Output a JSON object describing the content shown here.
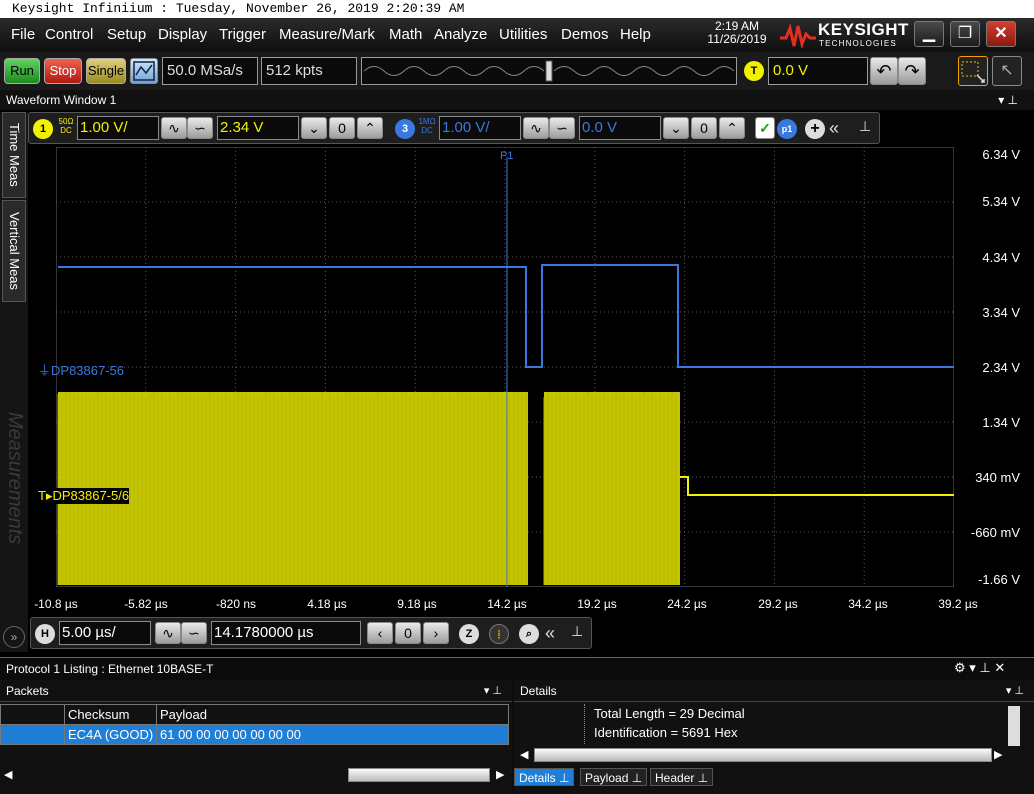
{
  "titlebar": {
    "text": "Keysight Infiniium : Tuesday, November 26, 2019 2:20:39 AM"
  },
  "menu": [
    "File",
    "Control",
    "Setup",
    "Display",
    "Trigger",
    "Measure/Mark",
    "Math",
    "Analyze",
    "Utilities",
    "Demos",
    "Help"
  ],
  "clock": {
    "time": "2:19 AM",
    "date": "11/26/2019"
  },
  "brand": {
    "name": "KEYSIGHT",
    "sub": "TECHNOLOGIES",
    "color": "#e03020"
  },
  "toolbar": {
    "run": "Run",
    "stop": "Stop",
    "single": "Single",
    "sample_rate": "50.0 MSa/s",
    "memory_depth": "512 kpts",
    "trigger_level": "0.0 V",
    "trigger_badge": "T"
  },
  "waveform_window": {
    "title": "Waveform Window 1"
  },
  "channels": {
    "ch1": {
      "badge": "1",
      "coupling_top": "50Ω",
      "coupling_bot": "DC",
      "scale": "1.00 V/",
      "offset": "2.34 V",
      "color": "#f2f200"
    },
    "ch3": {
      "badge": "3",
      "coupling_top": "1MΩ",
      "coupling_bot": "DC",
      "scale": "1.00 V/",
      "offset": "0.0 V",
      "color": "#3a78e0"
    }
  },
  "side_tabs": {
    "time_meas": "Time Meas",
    "vertical_meas": "Vertical Meas",
    "measurements": "Measurements"
  },
  "y_axis_labels": [
    "6.34 V",
    "5.34 V",
    "4.34 V",
    "3.34 V",
    "2.34 V",
    "1.34 V",
    "340 mV",
    "-660 mV",
    "-1.66 V"
  ],
  "x_axis_labels": [
    "-10.8 µs",
    "-5.82 µs",
    "-820 ns",
    "4.18 µs",
    "9.18 µs",
    "14.2 µs",
    "19.2 µs",
    "24.2 µs",
    "29.2 µs",
    "34.2 µs",
    "39.2 µs"
  ],
  "trace_labels": {
    "blue": "DP83867-56",
    "yellow": "DP83867-5/6"
  },
  "marker": {
    "label": "P1"
  },
  "timebase": {
    "badge": "H",
    "scale": "5.00 µs/",
    "position": "14.1780000 µs"
  },
  "protocol": {
    "title": "Protocol 1 Listing : Ethernet 10BASE-T",
    "packets_title": "Packets",
    "details_title": "Details",
    "columns": [
      "",
      "Checksum",
      "Payload"
    ],
    "rows": [
      {
        "index": "",
        "checksum": "EC4A (GOOD)",
        "payload": "61 00 00 00 00 00 00 00"
      }
    ],
    "details": [
      "Total Length = 29 Decimal",
      "Identification = 5691 Hex"
    ],
    "detail_tabs": [
      "Details",
      "Payload",
      "Header"
    ]
  }
}
